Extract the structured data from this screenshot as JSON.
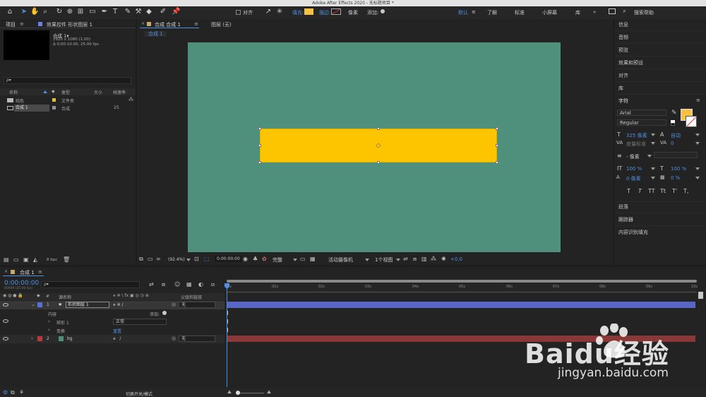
{
  "window": {
    "title": "Adobe After Effects 2020 - 无标题项目 *"
  },
  "toolbar": {
    "align_label": "对齐",
    "fill_label": "填充:",
    "stroke_label": "描边:",
    "stroke_unit": "像素",
    "add_label": "添加:",
    "fill_color": "#f7c244",
    "workspaces": [
      "默认",
      "了解",
      "标准",
      "小屏幕",
      "库"
    ],
    "search_help": "搜索帮助"
  },
  "project_panel": {
    "tab_project": "项目",
    "tab_effects": "效果控件 形状图层 1",
    "comp_name": "合成 1▾",
    "comp_res": "1920 x 1080 (1.00)",
    "comp_dur": "Δ 0:00:10:00, 25.00 fps",
    "search_icon": "ρ▾",
    "headers": {
      "name": "名称",
      "type": "类型",
      "size": "大小",
      "rate": "帧速率"
    },
    "items": [
      {
        "name": "纯色",
        "type": "文件夹",
        "rate": "",
        "color": "#d9c342"
      },
      {
        "name": "合成 1",
        "type": "合成",
        "rate": "25",
        "color": "#8f8fa0"
      }
    ],
    "bpc": "8 bpc"
  },
  "comp_viewer": {
    "tab_comp": "合成 合成 1",
    "tab_layer": "图层 (无)",
    "breadcrumb": "合成 1",
    "bg_color": "#4f907c",
    "shape_color": "#fcc500",
    "footer": {
      "zoom": "(92.4%)",
      "time": "0:00:00:00",
      "quality": "完整",
      "camera": "活动摄像机",
      "views": "1个视图",
      "exposure": "+0.0"
    }
  },
  "right_panel": {
    "items": [
      "信息",
      "音频",
      "预览",
      "效果和预设",
      "对齐",
      "库"
    ],
    "character": {
      "title": "字符",
      "font": "Arial",
      "style": "Regular",
      "size": "325 像素",
      "leading": "自动",
      "kerning": "度量标准",
      "tracking": "0",
      "stroke_width": "- 像素",
      "vscale": "100 %",
      "hscale": "100 %",
      "baseline": "0 像素",
      "tsume": "0 %",
      "style_buttons": [
        "T",
        "T",
        "TT",
        "Tt",
        "T'",
        "T,"
      ],
      "fill_color": "#f7c244"
    },
    "bottom_items": [
      "段落",
      "跟踪器",
      "内容识别填充"
    ]
  },
  "timeline": {
    "tab": "合成 1",
    "timecode": "0:00:00:00",
    "fps_note": "00000 (25.00 fps)",
    "search_icon": "ρ▾",
    "headers": {
      "num": "#",
      "name": "源名称",
      "parent": "父级和链接"
    },
    "ruler": [
      "0s",
      "01s",
      "02s",
      "03s",
      "04s",
      "05s",
      "06s",
      "07s",
      "08s",
      "09s",
      "10s"
    ],
    "layers": [
      {
        "index": "1",
        "name": "形状图层 1",
        "parent": "无",
        "color": "#5a6fd8"
      },
      {
        "index": "2",
        "name": "bg",
        "parent": "无",
        "color": "#b83a3a"
      }
    ],
    "contents_label": "内容",
    "add_label": "添加:",
    "rect_label": "矩形 1",
    "blend_mode": "正常",
    "transform_label": "变换",
    "reset_label": "重置",
    "footer_toggle": "切换开关/模式"
  },
  "watermark": {
    "brand": "Baidu经验",
    "url": "jingyan.baidu.com"
  }
}
